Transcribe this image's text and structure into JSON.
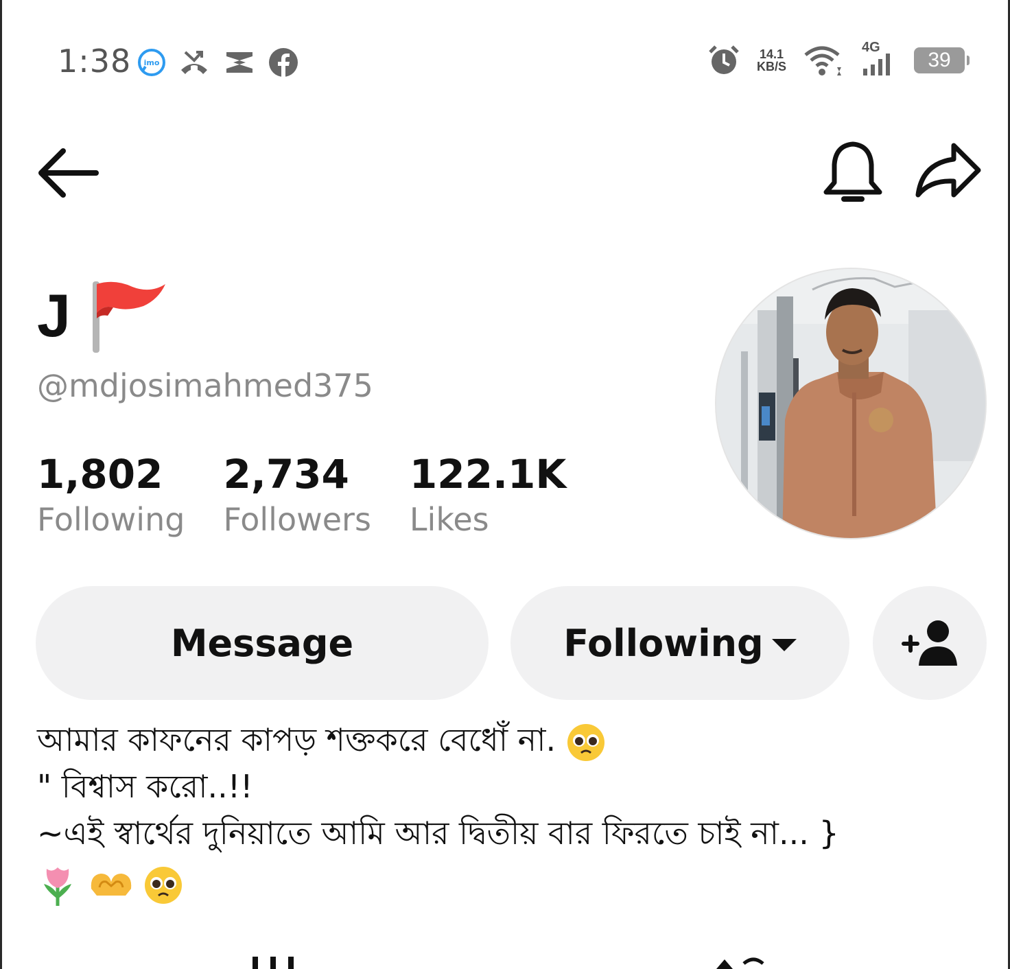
{
  "status_bar": {
    "time": "1:38",
    "net_speed_value": "14.1",
    "net_speed_unit": "KB/S",
    "network_type": "4G",
    "battery_level": "39",
    "left_icons": [
      "imo-icon",
      "missed-call-icon",
      "capcut-icon",
      "facebook-icon"
    ],
    "right_icons": [
      "alarm-icon",
      "wifi-icon",
      "signal-icon",
      "battery-icon"
    ]
  },
  "nav": {
    "back_icon": "back-arrow-icon",
    "bell_icon": "bell-icon",
    "share_icon": "share-icon"
  },
  "profile": {
    "display_name": "J",
    "username": "@mdjosimahmed375",
    "stats": [
      {
        "value": "1,802",
        "label": "Following"
      },
      {
        "value": "2,734",
        "label": "Followers"
      },
      {
        "value": "122.1K",
        "label": "Likes"
      }
    ]
  },
  "actions": {
    "message_label": "Message",
    "following_label": "Following",
    "add_friend_icon": "add-person-icon"
  },
  "bio": {
    "line1": "আমার কাফনের কাপড় শক্তকরে বেধোঁ না.",
    "line2": "\" বিশ্বাস করো..!!",
    "line3": "~এই স্বার্থের দুনিয়াতে আমি আর দ্বিতীয় বার ফিরতে চাই না... }"
  },
  "colors": {
    "text_primary": "#111111",
    "text_secondary": "#8a8a8a",
    "button_bg": "#f1f1f2",
    "flag_red": "#f0403a"
  }
}
